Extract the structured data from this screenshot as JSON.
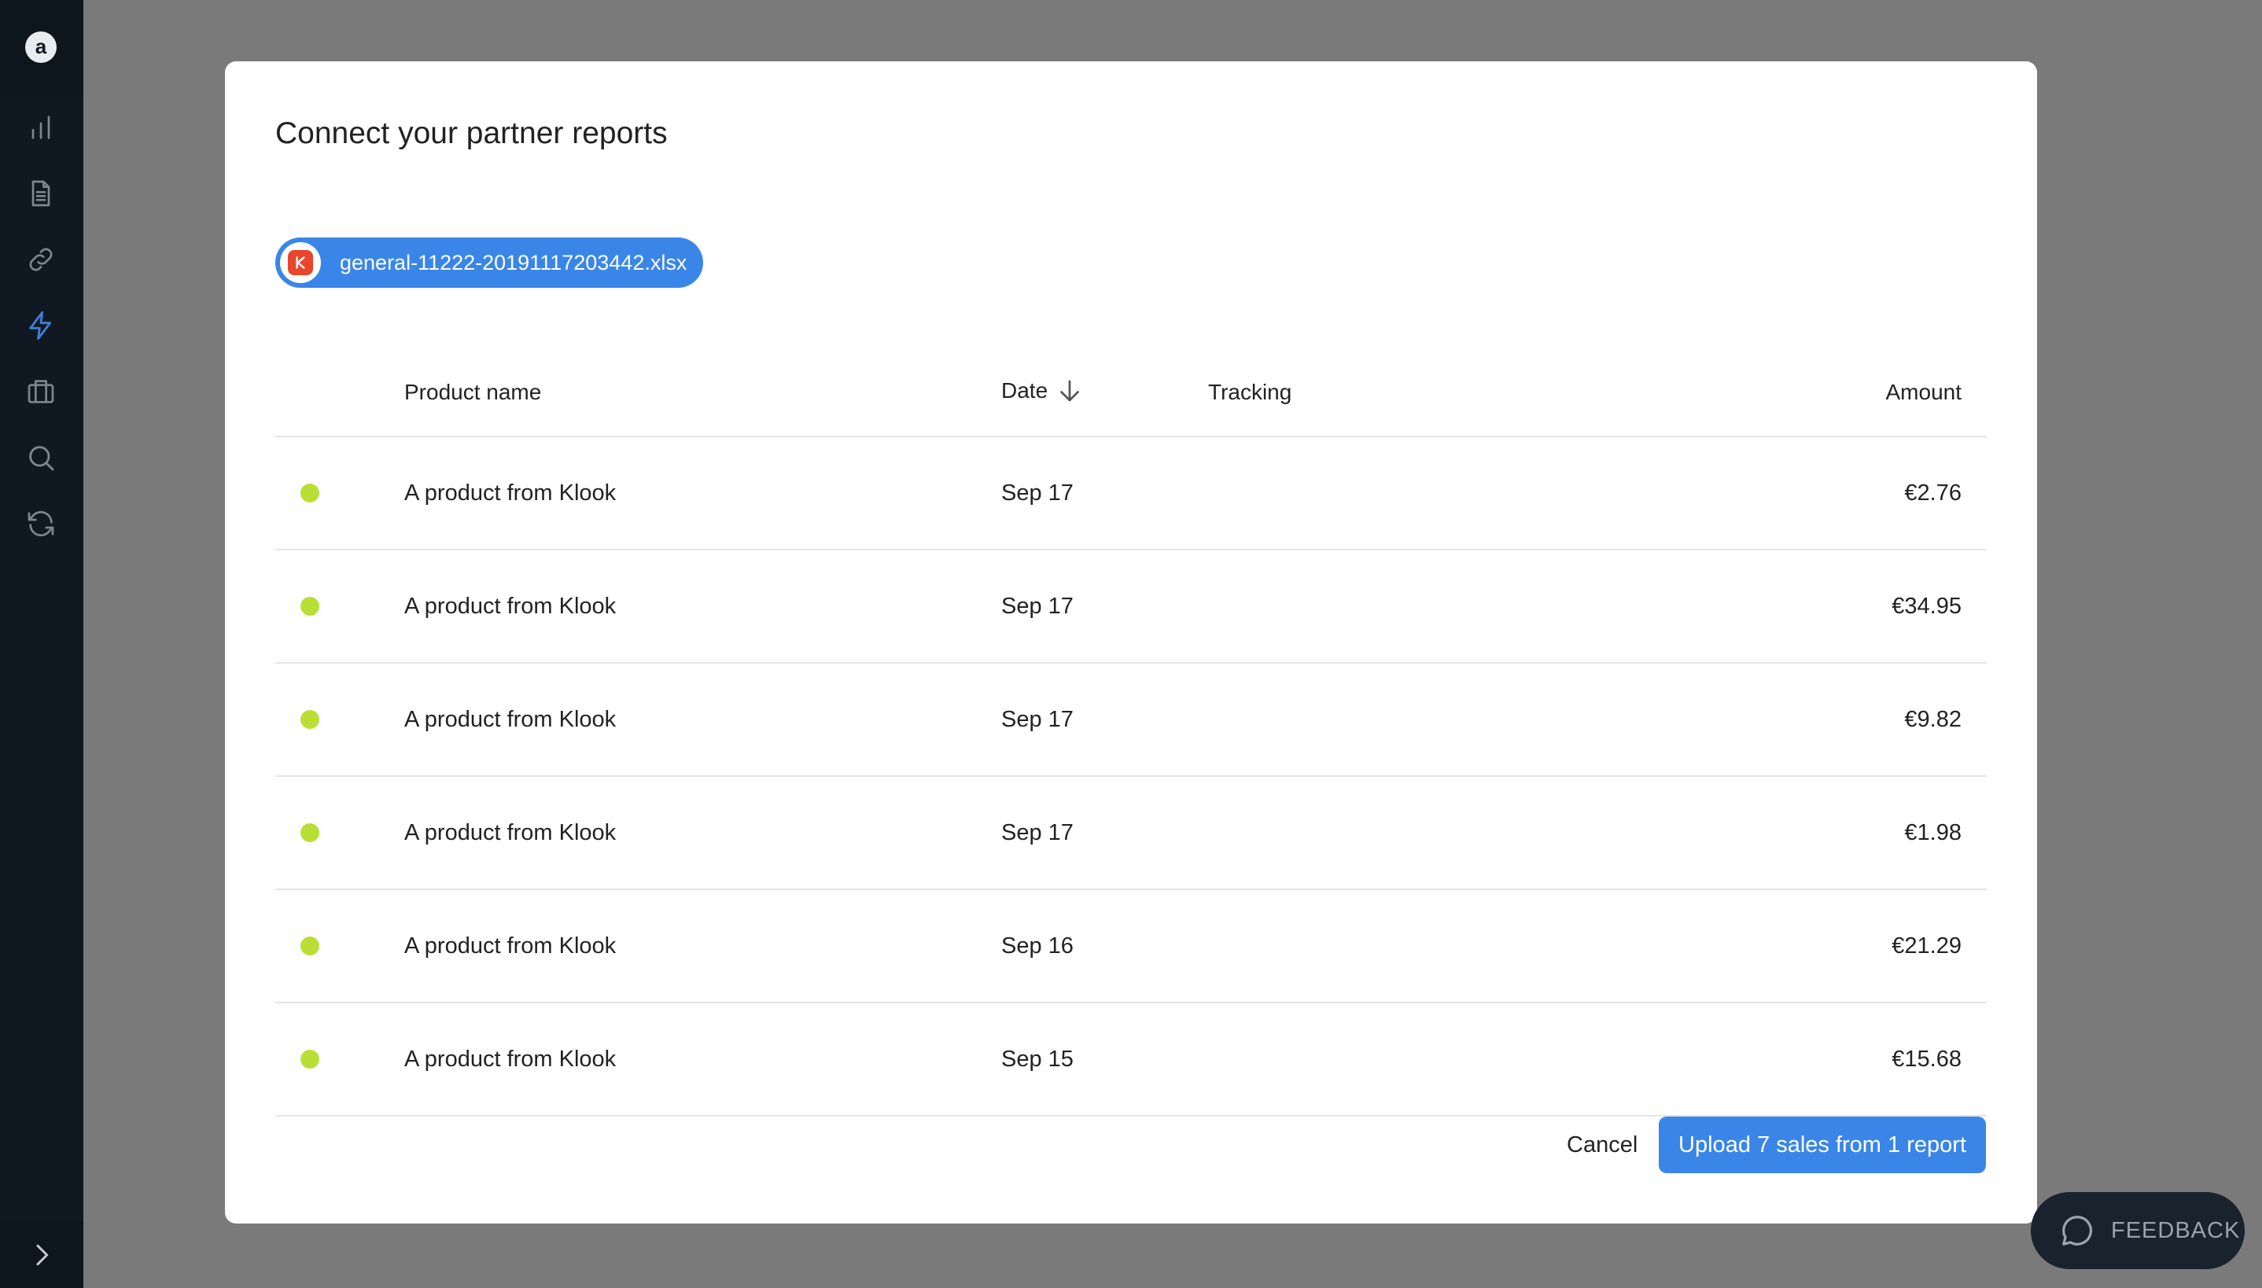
{
  "sidebar": {
    "logo_letter": "a",
    "icons": [
      "bar-chart-icon",
      "document-icon",
      "link-icon",
      "lightning-icon",
      "briefcase-icon",
      "search-icon",
      "refresh-icon"
    ],
    "active_icon": "lightning-icon",
    "expand_icon": "chevron-right-icon"
  },
  "modal": {
    "title": "Connect your partner reports",
    "file_chip": {
      "filename": "general-11222-20191117203442.xlsx",
      "icon": "klook-logo-icon"
    },
    "table": {
      "columns": {
        "product": "Product name",
        "date": "Date",
        "tracking": "Tracking",
        "amount": "Amount"
      },
      "rows": [
        {
          "product": "A product from Klook",
          "date": "Sep 17",
          "tracking": "",
          "amount": "€2.76"
        },
        {
          "product": "A product from Klook",
          "date": "Sep 17",
          "tracking": "",
          "amount": "€34.95"
        },
        {
          "product": "A product from Klook",
          "date": "Sep 17",
          "tracking": "",
          "amount": "€9.82"
        },
        {
          "product": "A product from Klook",
          "date": "Sep 17",
          "tracking": "",
          "amount": "€1.98"
        },
        {
          "product": "A product from Klook",
          "date": "Sep 16",
          "tracking": "",
          "amount": "€21.29"
        },
        {
          "product": "A product from Klook",
          "date": "Sep 15",
          "tracking": "",
          "amount": "€15.68"
        }
      ]
    },
    "cancel_label": "Cancel",
    "upload_label": "Upload 7 sales from 1 report"
  },
  "feedback": {
    "label": "FEEDBACK"
  },
  "colors": {
    "accent": "#3a86e8",
    "status_ok": "#b9df37",
    "sidebar_bg": "#101922"
  }
}
